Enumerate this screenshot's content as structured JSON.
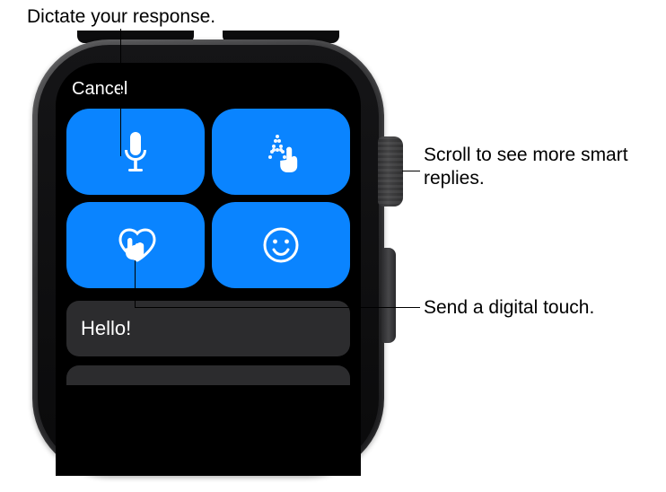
{
  "callouts": {
    "dictate": "Dictate your response.",
    "scroll": "Scroll to see more smart replies.",
    "digital_touch": "Send a digital touch."
  },
  "screen": {
    "cancel_label": "Cancel",
    "buttons": {
      "dictate_icon": "microphone-icon",
      "scribble_icon": "scribble-icon",
      "digital_touch_icon": "digital-touch-icon",
      "emoji_icon": "emoji-icon"
    },
    "smart_replies": [
      "Hello!"
    ]
  },
  "colors": {
    "button_blue": "#0a84ff",
    "reply_gray": "#2c2c2e"
  }
}
